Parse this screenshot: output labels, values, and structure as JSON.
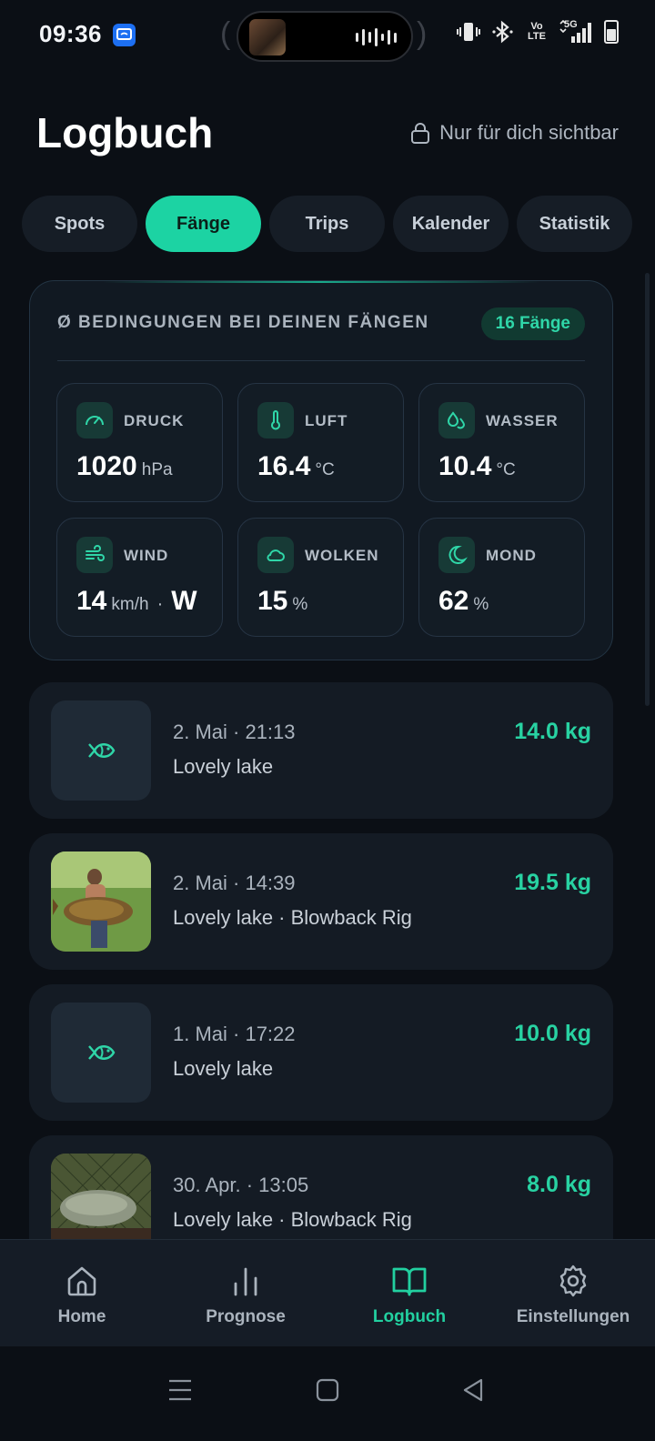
{
  "status": {
    "time": "09:36",
    "icons": [
      "vibrate-icon",
      "bluetooth-icon",
      "volte-icon",
      "5g-signal-icon",
      "battery-icon"
    ],
    "volte_label": "Vo LTE",
    "net_label": "5G"
  },
  "header": {
    "title": "Logbuch",
    "privacy_label": "Nur für dich sichtbar"
  },
  "tabs": [
    {
      "label": "Spots",
      "active": false
    },
    {
      "label": "Fänge",
      "active": true
    },
    {
      "label": "Trips",
      "active": false
    },
    {
      "label": "Kalender",
      "active": false
    },
    {
      "label": "Statistik",
      "active": false
    }
  ],
  "conditions": {
    "title": "Ø BEDINGUNGEN BEI DEINEN FÄNGEN",
    "count_badge": "16 Fänge",
    "stats": [
      {
        "label": "DRUCK",
        "value": "1020",
        "unit": "hPa",
        "icon": "gauge-icon"
      },
      {
        "label": "LUFT",
        "value": "16.4",
        "unit": "°C",
        "icon": "thermometer-icon"
      },
      {
        "label": "WASSER",
        "value": "10.4",
        "unit": "°C",
        "icon": "water-drops-icon"
      },
      {
        "label": "WIND",
        "value": "14",
        "unit": "km/h",
        "separator": "·",
        "direction": "W",
        "icon": "wind-icon"
      },
      {
        "label": "WOLKEN",
        "value": "15",
        "unit": "%",
        "icon": "cloud-icon"
      },
      {
        "label": "MOND",
        "value": "62",
        "unit": "%",
        "icon": "moon-icon"
      }
    ]
  },
  "catches": [
    {
      "date": "2. Mai · 21:13",
      "place": "Lovely lake",
      "weight": "14.0 kg",
      "thumb": "fish-icon"
    },
    {
      "date": "2. Mai · 14:39",
      "place": "Lovely lake  · Blowback Rig",
      "weight": "19.5 kg",
      "thumb": "photo"
    },
    {
      "date": "1. Mai · 17:22",
      "place": "Lovely lake",
      "weight": "10.0 kg",
      "thumb": "fish-icon"
    },
    {
      "date": "30. Apr. · 13:05",
      "place": "Lovely lake  · Blowback Rig",
      "weight": "8.0 kg",
      "thumb": "photo"
    }
  ],
  "bottom_nav": [
    {
      "label": "Home",
      "icon": "home-icon",
      "active": false
    },
    {
      "label": "Prognose",
      "icon": "bar-chart-icon",
      "active": false
    },
    {
      "label": "Logbuch",
      "icon": "book-icon",
      "active": true
    },
    {
      "label": "Einstellungen",
      "icon": "gear-icon",
      "active": false
    }
  ],
  "colors": {
    "background": "#0b0f15",
    "accent": "#1cd3a3",
    "card": "#141b24"
  }
}
